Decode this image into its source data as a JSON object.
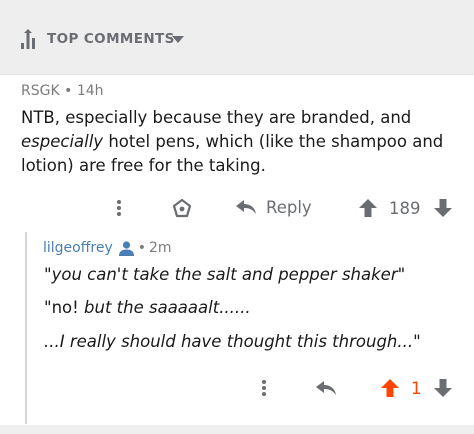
{
  "sort_bar": {
    "label": "TOP COMMENTS",
    "icon": "bar-sort-icon",
    "caret": "chevron-down-icon"
  },
  "comment": {
    "author": "RSGK",
    "separator": "•",
    "age": "14h",
    "body": {
      "part1": "NTB, especially because they are branded, and ",
      "part2_em": "especially",
      "part3": " hotel pens, which (like the shampoo and lotion) are free for the taking."
    },
    "actions": {
      "more": "more-dots-icon",
      "award": "award-icon",
      "reply_label": "Reply",
      "score": "189"
    }
  },
  "reply": {
    "author": "lilgeoffrey",
    "author_icon": "person-icon",
    "separator": "•",
    "age": "2m",
    "lines": {
      "l1_open": "\"",
      "l1_em": "you can't take the salt and pepper shaker",
      "l1_close": "\"",
      "l2_open": "\"no! ",
      "l2_em": "but the saaaaalt......",
      "l3_em": "...I really should have thought this through...",
      "l3_close": "\""
    },
    "actions": {
      "more": "more-dots-icon",
      "reply": "reply-arrow-icon",
      "score": "1",
      "upvoted": true
    }
  },
  "colors": {
    "upvote_active": "#ff4500",
    "username": "#4a7fb5",
    "muted": "#6a6e72"
  }
}
